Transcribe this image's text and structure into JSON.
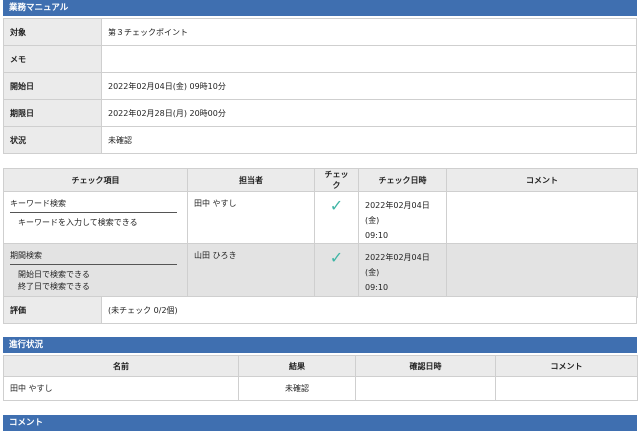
{
  "manual": {
    "title": "業務マニュアル",
    "rows": [
      {
        "label": "対象",
        "value": "第３チェックポイント"
      },
      {
        "label": "メモ",
        "value": ""
      },
      {
        "label": "開始日",
        "value": "2022年02月04日(金) 09時10分"
      },
      {
        "label": "期限日",
        "value": "2022年02月28日(月) 20時00分"
      },
      {
        "label": "状況",
        "value": "未確認"
      }
    ]
  },
  "checklist": {
    "headers": [
      "チェック項目",
      "担当者",
      "チェック",
      "チェック日時",
      "コメント"
    ],
    "rows": [
      {
        "item": "キーワード検索",
        "details": [
          "キーワードを入力して検索できる"
        ],
        "assignee": "田中 やすし",
        "check_mark": "✓",
        "datetime_line1": "2022年02月04日(金)",
        "datetime_line2": "09:10",
        "comment": ""
      },
      {
        "item": "期間検索",
        "details": [
          "開始日で検索できる",
          "終了日で検索できる"
        ],
        "assignee": "山田 ひろき",
        "check_mark": "✓",
        "datetime_line1": "2022年02月04日(金)",
        "datetime_line2": "09:10",
        "comment": ""
      }
    ]
  },
  "evaluation": {
    "label": "評価",
    "value": "(未チェック 0/2個)"
  },
  "progress": {
    "title": "進行状況",
    "headers": [
      "名前",
      "結果",
      "確認日時",
      "コメント"
    ],
    "rows": [
      {
        "name": "田中 やすし",
        "result": "未確認",
        "confirmed": "",
        "comment": ""
      }
    ]
  },
  "comments": {
    "title": "コメント"
  },
  "colors": {
    "header_bar": "#3f6fb0",
    "check_mark": "#3fb5a5"
  }
}
